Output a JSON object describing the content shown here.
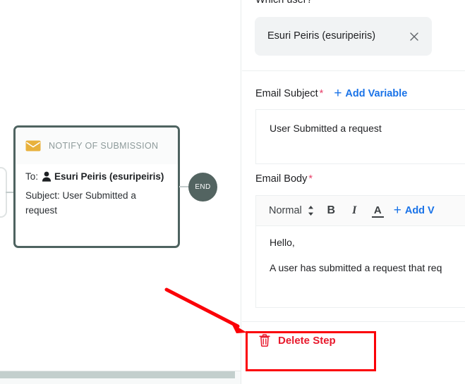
{
  "canvas": {
    "node": {
      "type_label": "NOTIFY OF SUBMISSION",
      "icon": "envelope-icon",
      "to_label": "To:",
      "recipient": "Esuri Peiris (esuripeiris)",
      "subject_line": "Subject: User Submitted a request",
      "border_color": "#4e6360",
      "icon_color": "#e8b13c"
    },
    "end_node": {
      "label": "END",
      "color": "#536461"
    }
  },
  "panel": {
    "which_user": {
      "label": "Which user?",
      "chip_value": "Esuri Peiris (esuripeiris)",
      "remove_icon": "close-icon"
    },
    "email_subject": {
      "label": "Email Subject",
      "required_marker": "*",
      "add_variable_label": "Add Variable",
      "add_variable_plus": "+",
      "value": "User Submitted a request",
      "link_color": "#1a73e8"
    },
    "email_body": {
      "label": "Email Body",
      "required_marker": "*",
      "toolbar": {
        "format_select": "Normal",
        "stepper_icon": "updown-stepper-icon",
        "bold_label": "B",
        "italic_label": "I",
        "text_color_label": "A",
        "add_variable_plus": "+",
        "add_variable_label": "Add V"
      },
      "paragraphs": [
        "Hello,",
        "A user has submitted a request that req"
      ]
    },
    "footer": {
      "delete_label": "Delete Step",
      "delete_icon": "trash-icon",
      "delete_color": "#e8192c"
    }
  },
  "annotations": {
    "highlight_color": "#fb0007",
    "arrow": "red-arrow-pointing-to-delete-step",
    "rectangle": "red-box-around-delete-step"
  }
}
